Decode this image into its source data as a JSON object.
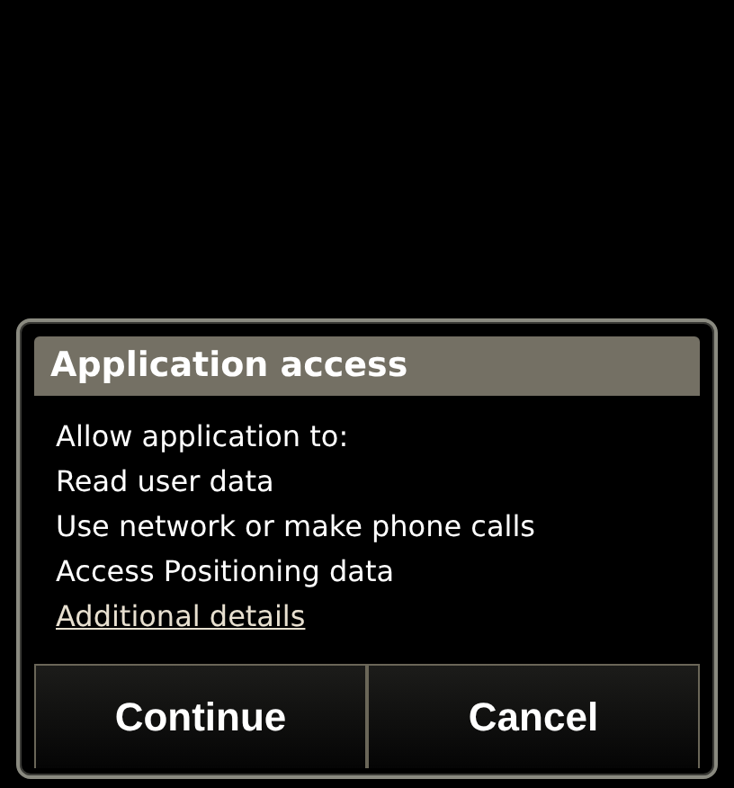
{
  "dialog": {
    "title": "Application access",
    "lines": [
      "Allow application to:",
      "Read user data",
      "Use network or make phone calls",
      "Access Positioning data"
    ],
    "link": "Additional details",
    "buttons": [
      "Continue",
      "Cancel"
    ]
  }
}
